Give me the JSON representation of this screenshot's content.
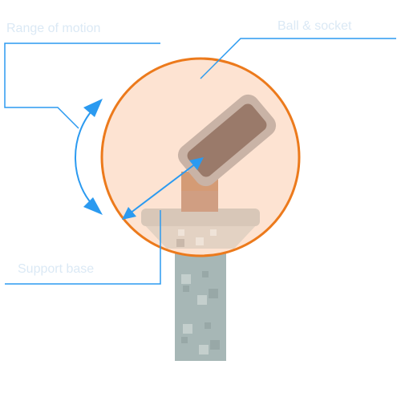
{
  "labels": {
    "range_of_motion": "Range of motion",
    "ball_and_socket": "Ball & socket",
    "support_base": "Support base"
  },
  "colors": {
    "background": "#ffffff",
    "callout_line": "#2b9af0",
    "circle_fill": "#fde3d2",
    "circle_stroke": "#ec7a1c",
    "ball_outer": "#c9b3a6",
    "ball_inner": "#9a7a6a",
    "neck": "#d49b75",
    "base_plate": "#d8c7b8",
    "column": "#a7b7b6",
    "column_speckle": "#c4cfcd",
    "label_text": "#dbe9f5"
  },
  "icons": [
    "rotation-arrow-icon",
    "double-arrow-icon"
  ]
}
